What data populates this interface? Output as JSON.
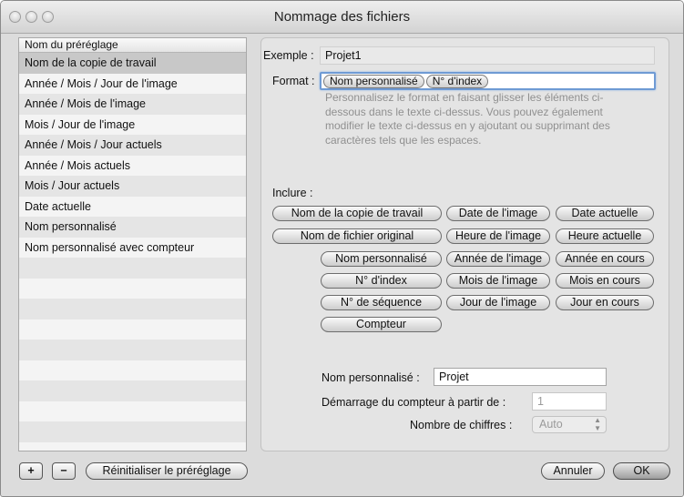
{
  "window": {
    "title": "Nommage des fichiers"
  },
  "preset_list": {
    "header": "Nom du préréglage",
    "items": [
      "Nom de la copie de travail",
      "Année / Mois / Jour de l'image",
      "Année / Mois de l'image",
      "Mois / Jour de l'image",
      "Année / Mois / Jour actuels",
      "Année / Mois actuels",
      "Mois / Jour actuels",
      "Date actuelle",
      "Nom personnalisé",
      "Nom personnalisé avec compteur"
    ],
    "selected_index": 0
  },
  "example": {
    "label": "Exemple :",
    "value": "Projet1"
  },
  "format": {
    "label": "Format :",
    "tokens": [
      "Nom personnalisé",
      "N° d'index"
    ],
    "help": "Personnalisez le format en faisant glisser les éléments ci-dessous dans le texte ci-dessus. Vous pouvez également modifier le texte ci-dessus en y ajoutant ou supprimant des caractères tels que les espaces."
  },
  "include": {
    "label": "Inclure :",
    "chips": [
      "Nom de la copie de travail",
      "Date de l'image",
      "Date actuelle",
      "Nom de fichier original",
      "Heure de l'image",
      "Heure actuelle",
      "Nom personnalisé",
      "Année de l'image",
      "Année en cours",
      "N° d'index",
      "Mois de l'image",
      "Mois en cours",
      "N° de séquence",
      "Jour de l'image",
      "Jour en cours",
      "Compteur"
    ]
  },
  "custom_name": {
    "label": "Nom personnalisé :",
    "value": "Projet"
  },
  "counter_start": {
    "label": "Démarrage du compteur à partir de :",
    "value": "1"
  },
  "digits": {
    "label": "Nombre de chiffres :",
    "value": "Auto"
  },
  "buttons": {
    "add": "+",
    "remove": "−",
    "reset": "Réinitialiser le préréglage",
    "cancel": "Annuler",
    "ok": "OK"
  }
}
